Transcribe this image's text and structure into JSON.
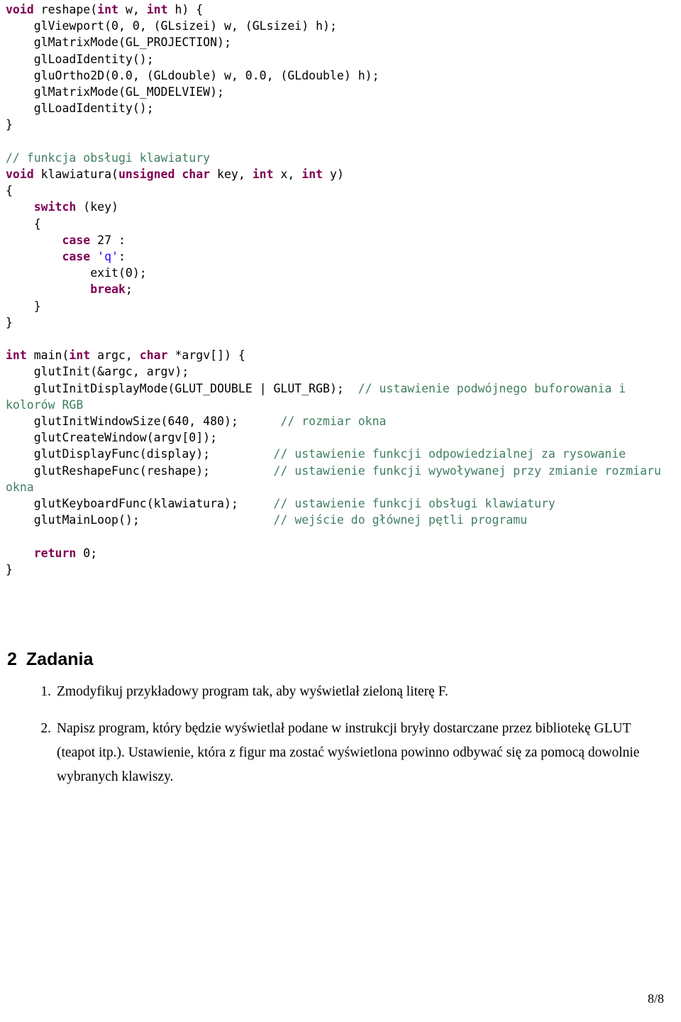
{
  "document": {
    "code_listing": [
      [
        {
          "t": "void ",
          "c": "kw"
        },
        {
          "t": "reshape(",
          "c": "plain"
        },
        {
          "t": "int",
          "c": "kw"
        },
        {
          "t": " w, ",
          "c": "plain"
        },
        {
          "t": "int",
          "c": "kw"
        },
        {
          "t": " h) {",
          "c": "plain"
        }
      ],
      [
        {
          "t": "    glViewport(0, 0, (GLsizei) w, (GLsizei) h);",
          "c": "plain"
        }
      ],
      [
        {
          "t": "    glMatrixMode(GL_PROJECTION);",
          "c": "plain"
        }
      ],
      [
        {
          "t": "    glLoadIdentity();",
          "c": "plain"
        }
      ],
      [
        {
          "t": "    gluOrtho2D(0.0, (GLdouble) w, 0.0, (GLdouble) h);",
          "c": "plain"
        }
      ],
      [
        {
          "t": "    glMatrixMode(GL_MODELVIEW);",
          "c": "plain"
        }
      ],
      [
        {
          "t": "    glLoadIdentity();",
          "c": "plain"
        }
      ],
      [
        {
          "t": "}",
          "c": "plain"
        }
      ],
      [
        {
          "t": "",
          "c": "plain"
        }
      ],
      [
        {
          "t": "// funkcja obsługi klawiatury",
          "c": "cmt"
        }
      ],
      [
        {
          "t": "void ",
          "c": "kw"
        },
        {
          "t": "klawiatura(",
          "c": "plain"
        },
        {
          "t": "unsigned char",
          "c": "kw"
        },
        {
          "t": " key, ",
          "c": "plain"
        },
        {
          "t": "int",
          "c": "kw"
        },
        {
          "t": " x, ",
          "c": "plain"
        },
        {
          "t": "int",
          "c": "kw"
        },
        {
          "t": " y)",
          "c": "plain"
        }
      ],
      [
        {
          "t": "{",
          "c": "plain"
        }
      ],
      [
        {
          "t": "    ",
          "c": "plain"
        },
        {
          "t": "switch",
          "c": "kw"
        },
        {
          "t": " (key)",
          "c": "plain"
        }
      ],
      [
        {
          "t": "    {",
          "c": "plain"
        }
      ],
      [
        {
          "t": "        ",
          "c": "plain"
        },
        {
          "t": "case",
          "c": "kw"
        },
        {
          "t": " 27 :",
          "c": "plain"
        }
      ],
      [
        {
          "t": "        ",
          "c": "plain"
        },
        {
          "t": "case",
          "c": "kw"
        },
        {
          "t": " ",
          "c": "plain"
        },
        {
          "t": "'q'",
          "c": "str"
        },
        {
          "t": ":",
          "c": "plain"
        }
      ],
      [
        {
          "t": "            exit(0);",
          "c": "plain"
        }
      ],
      [
        {
          "t": "            ",
          "c": "plain"
        },
        {
          "t": "break",
          "c": "kw"
        },
        {
          "t": ";",
          "c": "plain"
        }
      ],
      [
        {
          "t": "    }",
          "c": "plain"
        }
      ],
      [
        {
          "t": "}",
          "c": "plain"
        }
      ],
      [
        {
          "t": "",
          "c": "plain"
        }
      ],
      [
        {
          "t": "int ",
          "c": "kw"
        },
        {
          "t": "main(",
          "c": "plain"
        },
        {
          "t": "int",
          "c": "kw"
        },
        {
          "t": " argc, ",
          "c": "plain"
        },
        {
          "t": "char",
          "c": "kw"
        },
        {
          "t": " *argv[]) {",
          "c": "plain"
        }
      ],
      [
        {
          "t": "    glutInit(&argc, argv);",
          "c": "plain"
        }
      ],
      [
        {
          "t": "    glutInitDisplayMode(GLUT_DOUBLE | GLUT_RGB);  ",
          "c": "plain"
        },
        {
          "t": "// ustawienie podwójnego buforowania i kolorów RGB",
          "c": "cmt"
        }
      ],
      [
        {
          "t": "    glutInitWindowSize(640, 480);      ",
          "c": "plain"
        },
        {
          "t": "// rozmiar okna",
          "c": "cmt"
        }
      ],
      [
        {
          "t": "    glutCreateWindow(argv[0]);",
          "c": "plain"
        }
      ],
      [
        {
          "t": "    glutDisplayFunc(display);         ",
          "c": "plain"
        },
        {
          "t": "// ustawienie funkcji odpowiedzialnej za rysowanie",
          "c": "cmt"
        }
      ],
      [
        {
          "t": "    glutReshapeFunc(reshape);         ",
          "c": "plain"
        },
        {
          "t": "// ustawienie funkcji wywoływanej przy zmianie rozmiaru okna",
          "c": "cmt"
        }
      ],
      [
        {
          "t": "    glutKeyboardFunc(klawiatura);     ",
          "c": "plain"
        },
        {
          "t": "// ustawienie funkcji obsługi klawiatury",
          "c": "cmt"
        }
      ],
      [
        {
          "t": "    glutMainLoop();                   ",
          "c": "plain"
        },
        {
          "t": "// wejście do głównej pętli programu",
          "c": "cmt"
        }
      ],
      [
        {
          "t": "",
          "c": "plain"
        }
      ],
      [
        {
          "t": "    ",
          "c": "plain"
        },
        {
          "t": "return",
          "c": "kw"
        },
        {
          "t": " 0;",
          "c": "plain"
        }
      ],
      [
        {
          "t": "}",
          "c": "plain"
        }
      ]
    ],
    "section": {
      "number": "2",
      "title": "Zadania"
    },
    "tasks": [
      {
        "marker": "1.",
        "text": "Zmodyfikuj przykładowy program tak, aby wyświetlał zieloną literę F."
      },
      {
        "marker": "2.",
        "text": "Napisz program, który będzie wyświetlał podane w instrukcji bryły dostarczane przez bibliotekę GLUT (teapot itp.). Ustawienie, która z figur ma zostać wyświetlona powinno odbywać się za pomocą dowolnie wybranych klawiszy."
      }
    ],
    "footer": {
      "page_number": "8/8"
    }
  }
}
